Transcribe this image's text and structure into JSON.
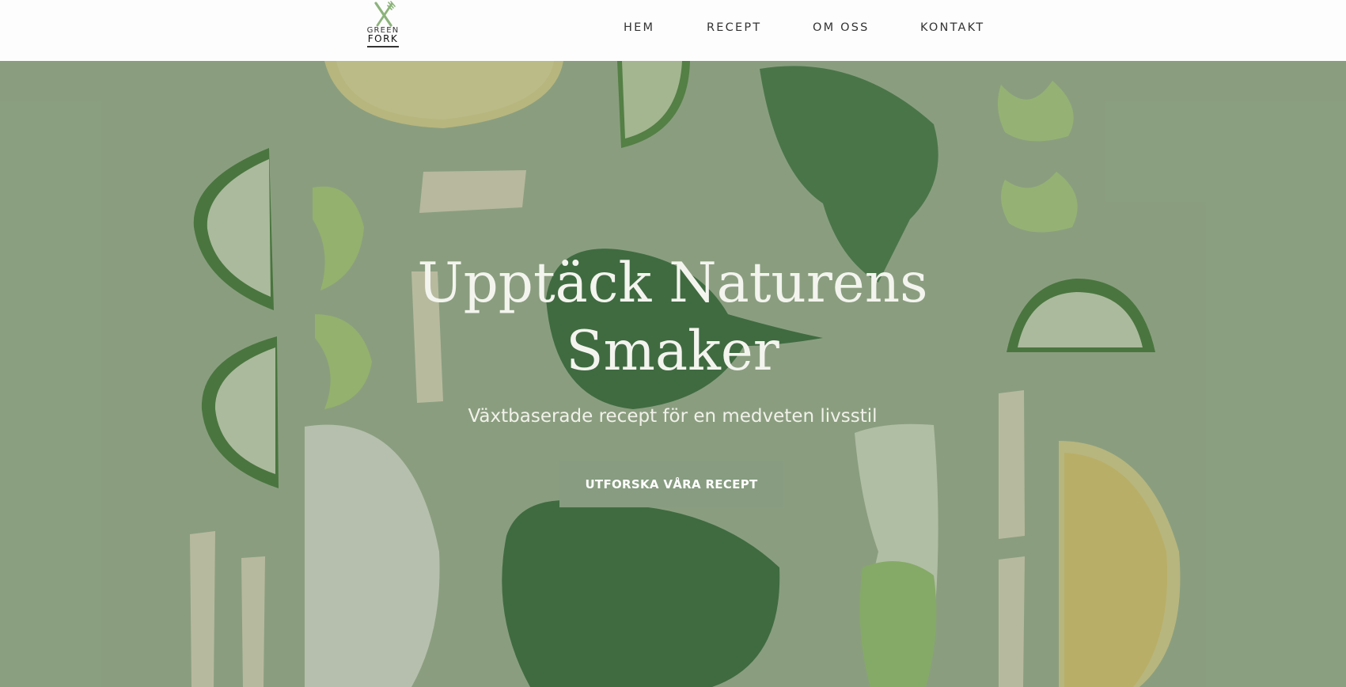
{
  "brand": {
    "logo_line1": "GREEN",
    "logo_line2": "FORK",
    "logo_icon": "crossed-knife-fork-icon",
    "accent_color": "#879c80"
  },
  "nav": {
    "items": [
      {
        "label": "HEM"
      },
      {
        "label": "RECEPT"
      },
      {
        "label": "OM OSS"
      },
      {
        "label": "KONTAKT"
      }
    ]
  },
  "hero": {
    "title_line1": "Upptäck Naturens",
    "title_line2": "Smaker",
    "subtitle": "Växtbaserade recept för en medveten livsstil",
    "cta_label": "UTFORSKA VÅRA RECEPT",
    "background": "vegetables-flatlay-photo"
  }
}
